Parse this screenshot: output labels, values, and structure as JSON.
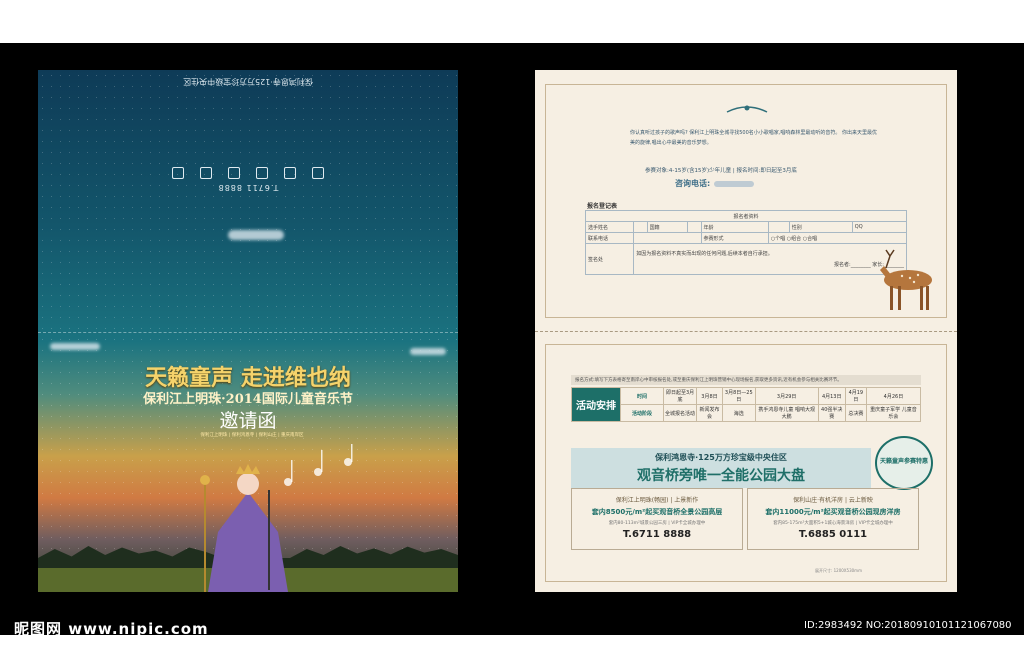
{
  "cover": {
    "upside_phone": "T.6711 8888",
    "upside_tagline": "保利鸿恩寺·125万方珍宝级中央住区",
    "title1": "天籁童声 走进维也纳",
    "title2": "保利江上明珠·2014国际儿童音乐节",
    "title3": "邀请函",
    "sub": "保利江上明珠 | 保利鸿恩寺 | 保利山庄 | 重庆南岸区"
  },
  "invitation": {
    "intro": "你认真听过孩子的歌声吗? 保利江上明珠全城寻找500名小小歌唱家,唱响森林里最动听的音符。 你出来天里最优美的旋律,唱出心中最美的音乐梦想。",
    "meta": "参赛对象:4-15岁(含15岁)少年儿童   |   报名时间:即日起至3月底",
    "hotline_label": "咨询电话:",
    "registration_title": "报名登记表",
    "form": {
      "header": "报名者资料",
      "name": "选手姓名",
      "nationality": "国籍",
      "age": "年龄",
      "gender": "性别",
      "qq": "QQ",
      "phone": "联系电话",
      "form_type": "参赛形式",
      "options": "○个唱   ○组合   ○合唱",
      "sign": "签名处",
      "sign_note": "如因为报名资料不真实而出现的任何问题,后续本者自行承担。",
      "sign_fields": "报名者:________   家长:________"
    },
    "schedule": {
      "note": "报名方式:填写下方表格寄至南岸心中审核报名处,或至重庆保利江上明珠营销中心现场报名,获取更多资讯,近有机会参与相关比赛环节。",
      "header": "活动安排",
      "row1_label": "时间",
      "row2_label": "活动阶段",
      "cols": [
        {
          "date": "即日起至3月底",
          "stage": "全城报名活动"
        },
        {
          "date": "3月8日",
          "stage": "新闻发布会"
        },
        {
          "date": "3月8日—25日",
          "stage": "海选"
        },
        {
          "date": "3月29日",
          "stage": "携手鸿恩寺儿童 唱响大观大鹏"
        },
        {
          "date": "4月13日",
          "stage": "40强半决赛"
        },
        {
          "date": "4月19日",
          "stage": "总决赛"
        },
        {
          "date": "4月26日",
          "stage": "重庆童子军学 儿童音乐会"
        }
      ]
    },
    "banner_line1": "保利鸿恩寺·125万方珍宝级中央住区",
    "banner_line2": "观音桥旁唯一全能公园大盘",
    "badge": "天籁童声参赛特惠",
    "projects": [
      {
        "title": "保利江上明珠(畅园) | 上景新作",
        "price": "套内8500元/m²起买观音桥全景公园高层",
        "desc": "套内80-113m²城景公园三房 | VIP卡全城办理中",
        "phone": "T.6711 8888"
      },
      {
        "title": "保利山庄·有机洋房 | 云上新映",
        "price": "套内11000元/m²起买观音桥公园现房洋房",
        "desc": "套内85-175m²大面积5+1城心海景洋房 | VIP卡全城办理中",
        "phone": "T.6885 0111"
      }
    ],
    "footer_note": "展开尺寸: 1200X530mm"
  },
  "watermark": {
    "left": "昵图网 www.nipic.com",
    "right": "ID:2983492 NO:20180910101121067080"
  },
  "colors": {
    "teal": "#1d6f68",
    "paper": "#f6efe3",
    "gold": "#f5d36b"
  }
}
